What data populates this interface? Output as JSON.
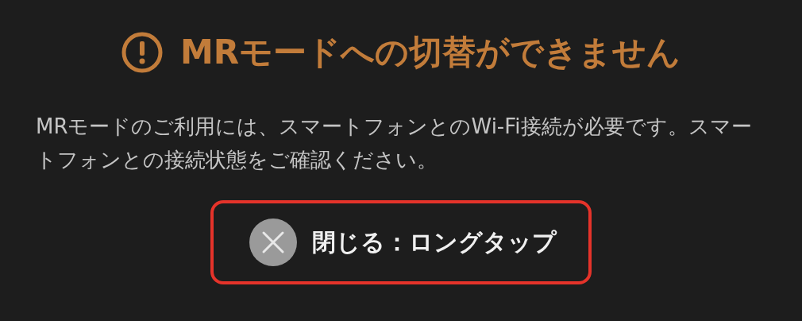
{
  "dialog": {
    "title": "MRモードへの切替ができません",
    "message": "MRモードのご利用には、スマートフォンとのWi-Fi接続が必要です。スマートフォンとの接続状態をご確認ください。",
    "close_button": {
      "label": "閉じる：ロングタップ",
      "selected": true
    }
  }
}
